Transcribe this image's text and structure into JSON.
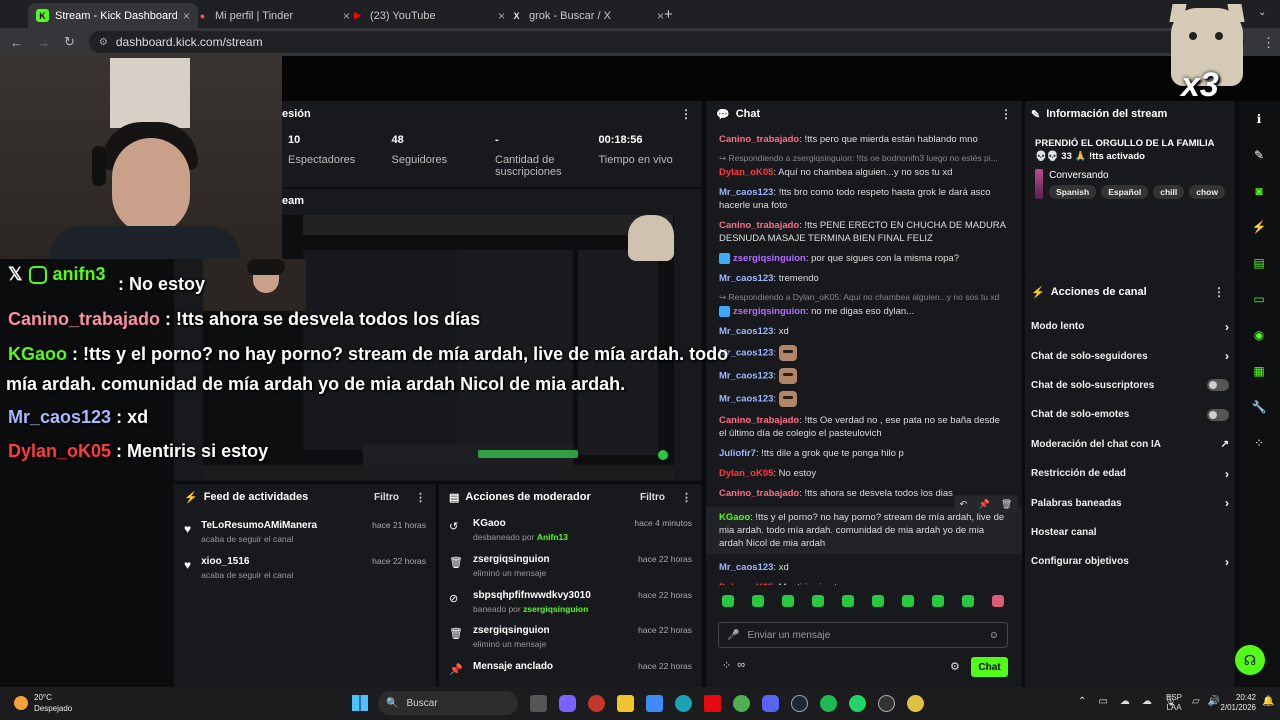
{
  "browser": {
    "tabs": [
      {
        "title": "Stream - Kick Dashboard",
        "active": true,
        "favicon": "kick-icon",
        "color": "#53fc18",
        "glyph": "K"
      },
      {
        "title": "Mi perfil | Tinder",
        "active": false,
        "favicon": "tinder-icon",
        "color": "#fd5068",
        "glyph": "●"
      },
      {
        "title": "(23) YouTube",
        "active": false,
        "favicon": "youtube-icon",
        "color": "#ff0000",
        "glyph": "▶"
      },
      {
        "title": "grok - Buscar / X",
        "active": false,
        "favicon": "x-icon",
        "color": "#e6e6e6",
        "glyph": "X"
      }
    ],
    "url": "dashboard.kick.com/stream"
  },
  "session": {
    "title_partial": "esión",
    "stats": [
      {
        "value": "10",
        "label": "Espectadores"
      },
      {
        "value": "48",
        "label": "Seguidores"
      },
      {
        "value": "-",
        "label": "Cantidad de suscripciones"
      },
      {
        "value": "00:18:56",
        "label": "Tiempo en vivo"
      }
    ],
    "stream_title_partial": "eam"
  },
  "chat": {
    "title": "Chat",
    "messages": [
      {
        "user": "Canino_trabajado",
        "color": "#ff6b8b",
        "text": "!tts pero que mierda están hablando mno"
      },
      {
        "reply": "Respondiendo a zsergiqsinguion: !tts oe bodrionifn3 luego no estés pi..."
      },
      {
        "user": "Dylan_oK05",
        "color": "#ff3b3b",
        "text": "Aquí no chambea alguien...y no sos tu xd"
      },
      {
        "user": "Mr_caos123",
        "color": "#9db6ff",
        "text": "!tts bro como todo respeto hasta grok le dará asco hacerle una foto"
      },
      {
        "user": "Canino_trabajado",
        "color": "#ff6b8b",
        "text": "!tts PENE ERECTO EN CHUCHA DE MADURA DESNUDA MASAJE TERMINA BIEN FINAL FELIZ"
      },
      {
        "user": "zsergiqsinguion",
        "color": "#b26bff",
        "text": "por que sigues con la misma ropa?",
        "badge": true
      },
      {
        "user": "Mr_caos123",
        "color": "#9db6ff",
        "text": "tremendo"
      },
      {
        "reply": "Respondiendo a Dylan_oK05: Aquí no chambea alguien...y no sos tu xd"
      },
      {
        "user": "zsergiqsinguion",
        "color": "#b26bff",
        "text": "no me digas eso dylan...",
        "badge": true
      },
      {
        "user": "Mr_caos123",
        "color": "#9db6ff",
        "text": "xd"
      },
      {
        "user": "Mr_caos123",
        "color": "#9db6ff",
        "text": "",
        "emote": true
      },
      {
        "user": "Mr_caos123",
        "color": "#9db6ff",
        "text": "",
        "emote": true
      },
      {
        "user": "Mr_caos123",
        "color": "#9db6ff",
        "text": "",
        "emote": true
      },
      {
        "user": "Canino_trabajado",
        "color": "#ff6b8b",
        "text": "!tts Oe verdad no , ese pata no se baña desde el último día de colegio el pasteulovich"
      },
      {
        "user": "Juliofir7",
        "color": "#9db6ff",
        "text": "!tts dile a grok que te ponga hilo p"
      },
      {
        "user": "Dylan_oK05",
        "color": "#ff3b3b",
        "text": "No estoy"
      },
      {
        "user": "Canino_trabajado",
        "color": "#ff6b8b",
        "text": "!tts ahora se desvela todos los dias"
      },
      {
        "user": "KGaoo",
        "color": "#53fc18",
        "text": "!tts y el porno? no hay porno? stream de mía ardah, live de mia ardah. todo mía ardah. comunidad de mia ardah yo de mia ardah Nicol de mia ardah"
      },
      {
        "user": "Mr_caos123",
        "color": "#9db6ff",
        "text": "xd"
      },
      {
        "user": "Dylan_oK05",
        "color": "#ff3b3b",
        "text": "Mentiris si estoy"
      }
    ],
    "input_placeholder": "Enviar un mensaje",
    "send_label": "Chat"
  },
  "stream_info": {
    "header": "Información del stream",
    "title": "PRENDIÓ EL ORGULLO DE LA FAMILIA 💀💀 33 🙏 !tts activado",
    "category": "Conversando",
    "tags": [
      "Spanish",
      "Español",
      "chill",
      "chow"
    ]
  },
  "channel_actions": {
    "header": "Acciones de canal",
    "items": [
      {
        "label": "Modo lento",
        "control": "chevron"
      },
      {
        "label": "Chat de solo-seguidores",
        "control": "chevron"
      },
      {
        "label": "Chat de solo-suscriptores",
        "control": "toggle"
      },
      {
        "label": "Chat de solo-emotes",
        "control": "toggle"
      },
      {
        "label": "Moderación del chat con IA",
        "control": "external"
      },
      {
        "label": "Restricción de edad",
        "control": "chevron"
      },
      {
        "label": "Palabras baneadas",
        "control": "chevron"
      },
      {
        "label": "Hostear canal",
        "control": "none"
      },
      {
        "label": "Configurar objetivos",
        "control": "chevron"
      }
    ]
  },
  "activity_feed": {
    "header": "Feed de actividades",
    "filter": "Filtro",
    "items": [
      {
        "name": "TeLoResumoAMiManera",
        "sub": "acaba de seguir el canal",
        "time": "hace 21 horas"
      },
      {
        "name": "xioo_1516",
        "sub": "acaba de seguir el canal",
        "time": "hace 22 horas"
      }
    ]
  },
  "mod_actions": {
    "header": "Acciones de moderador",
    "filter": "Filtro",
    "items": [
      {
        "name": "KGaoo",
        "sub": "desbaneado por",
        "by": "Anifn13",
        "time": "hace 4 minutos",
        "icon": "undo-icon"
      },
      {
        "name": "zsergiqsinguion",
        "sub": "eliminó un mensaje",
        "by": "",
        "time": "hace 22 horas",
        "icon": "trash-icon"
      },
      {
        "name": "sbpsqhpfifnwwdkvy3010",
        "sub": "baneado por",
        "by": "zsergiqsinguion",
        "time": "hace 22 horas",
        "icon": "ban-icon"
      },
      {
        "name": "zsergiqsinguion",
        "sub": "eliminó un mensaje",
        "by": "",
        "time": "hace 22 horas",
        "icon": "trash-icon"
      },
      {
        "name": "Mensaje anclado",
        "sub": "",
        "by": "",
        "time": "hace 22 horas",
        "icon": "pin-icon"
      }
    ]
  },
  "overlay": {
    "handle": "anifn3",
    "lines": [
      {
        "user": "",
        "text": ": No estoy"
      },
      {
        "user": "Canino_trabajado",
        "color": "#ff8ea8",
        "text": " : !tts ahora se desvela todos los días"
      },
      {
        "user": "KGaoo",
        "color": "#53fc18",
        "text": " : !tts y el porno? no hay porno? stream de mía ardah, live de mía ardah. todo"
      },
      {
        "user": "",
        "text": "mía ardah. comunidad de mía ardah yo de mia ardah Nicol de mia ardah."
      },
      {
        "user": "Mr_caos123",
        "color": "#a9b8ff",
        "text": " : xd"
      },
      {
        "user": "Dylan_oK05",
        "color": "#ff3b3b",
        "text": " : Mentiris si estoy"
      }
    ],
    "cat_multiplier": "x3"
  },
  "taskbar": {
    "weather_temp": "20°C",
    "weather_desc": "Despejado",
    "search": "Buscar",
    "lang": "ESP",
    "lang2": "LAA",
    "time": "20:42",
    "date": "2/01/2026"
  }
}
